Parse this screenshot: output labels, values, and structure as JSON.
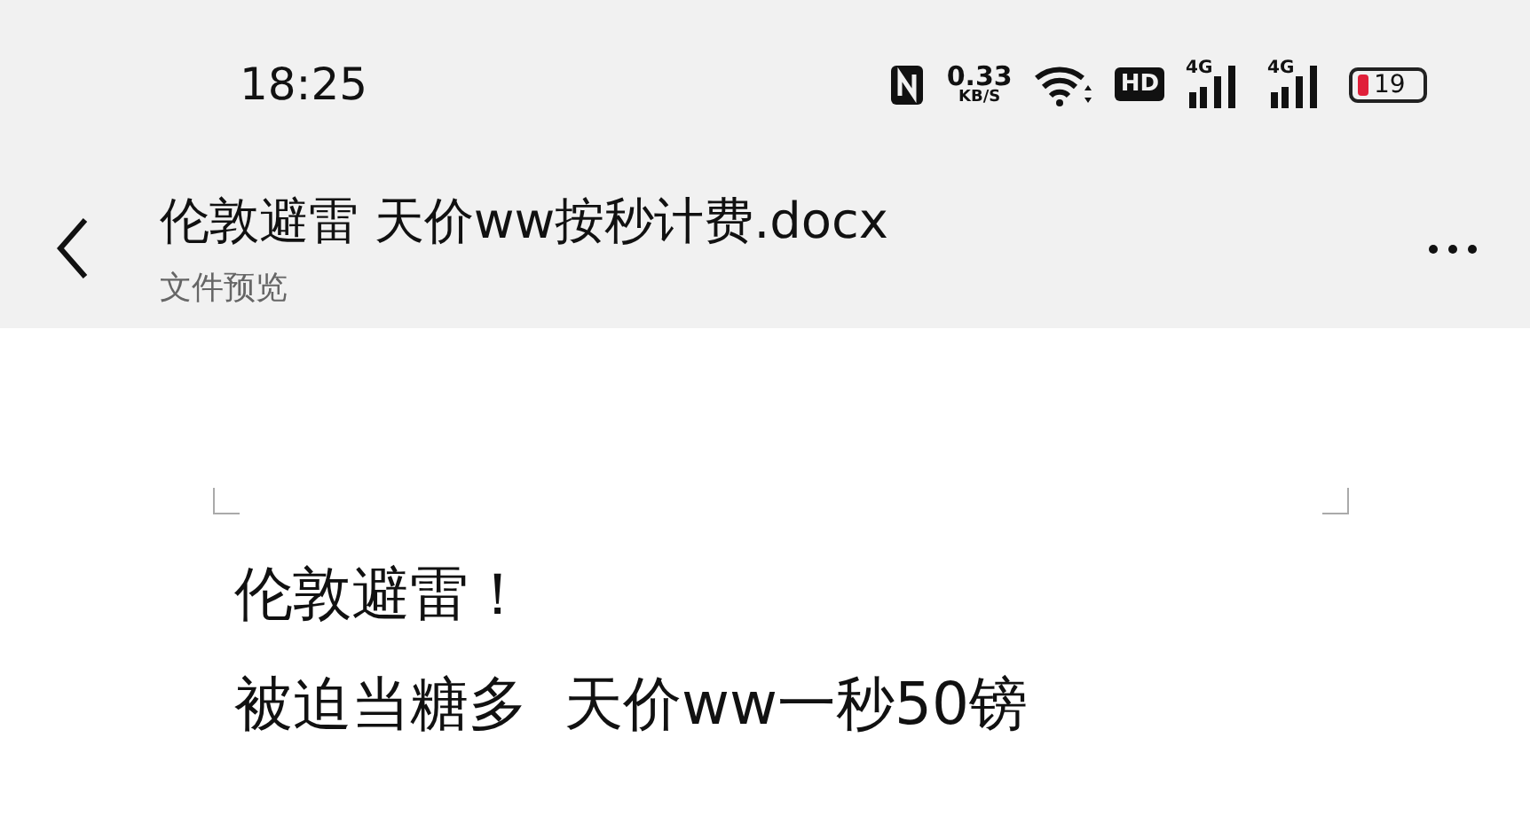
{
  "status_bar": {
    "time": "18:25",
    "net_speed": "0.33",
    "net_speed_unit": "KB/S",
    "hd": "HD",
    "signals": [
      {
        "label": "4G"
      },
      {
        "label": "4G"
      }
    ],
    "battery": "19"
  },
  "header": {
    "title": "伦敦避雷 天价ww按秒计费.docx",
    "subtitle": "文件预览"
  },
  "document": {
    "paragraphs": [
      "伦敦避雷！",
      "被迫当糖多  天价ww一秒50镑"
    ]
  }
}
